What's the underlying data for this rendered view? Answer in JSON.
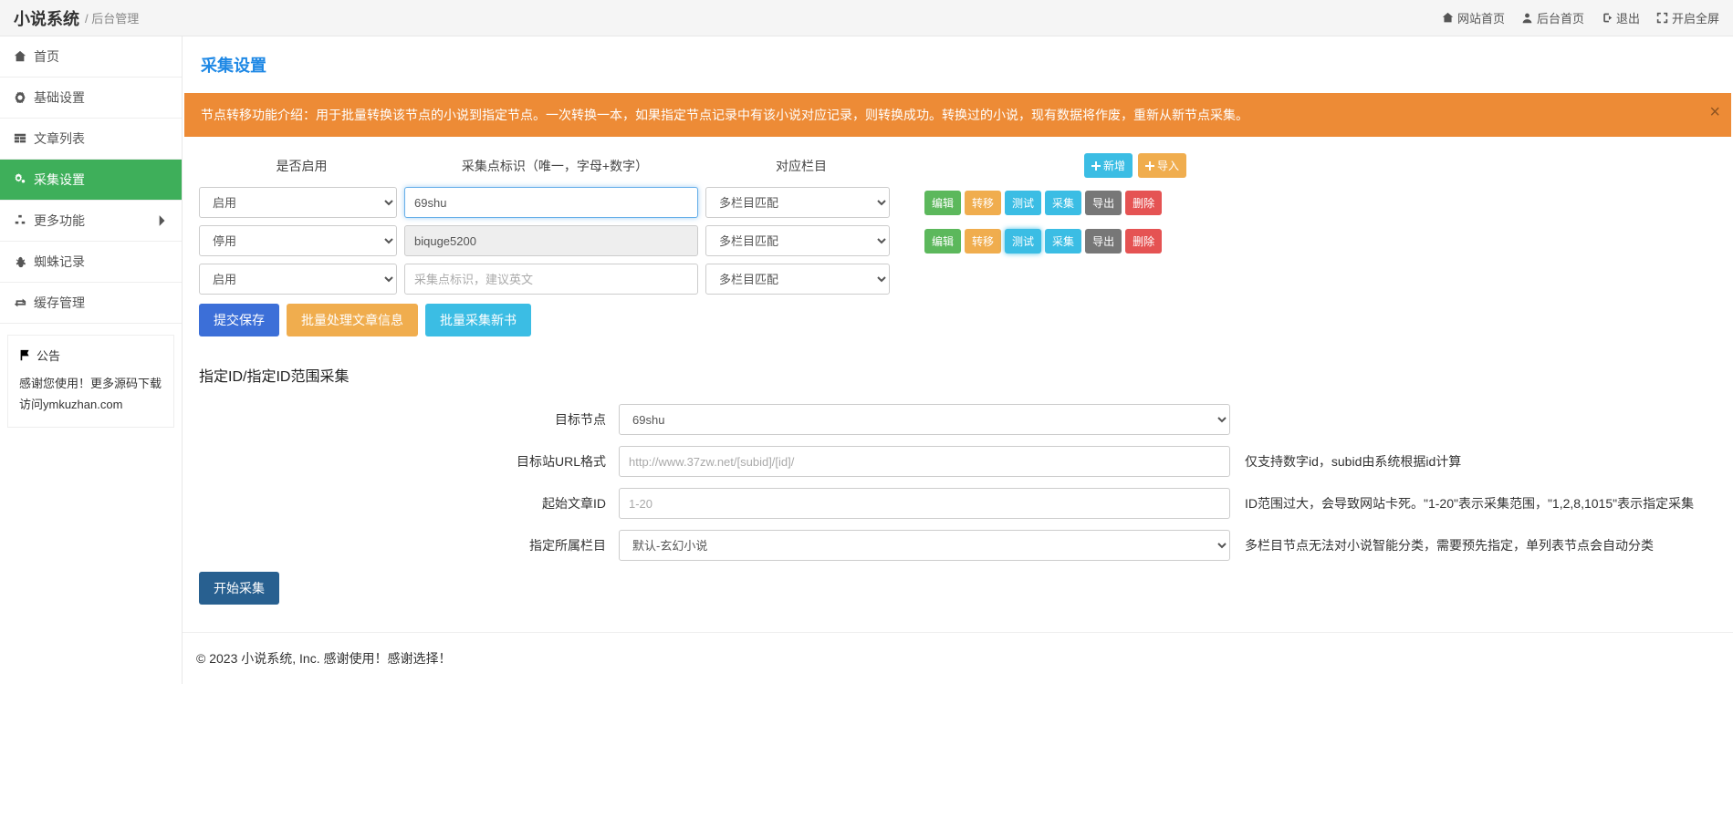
{
  "navbar": {
    "brand": "小说系统",
    "brand_sub": "/ 后台管理",
    "links": {
      "site_home": "网站首页",
      "admin_home": "后台首页",
      "logout": "退出",
      "fullscreen": "开启全屏"
    }
  },
  "sidebar": {
    "items": [
      {
        "icon": "home",
        "label": "首页"
      },
      {
        "icon": "gear",
        "label": "基础设置"
      },
      {
        "icon": "table",
        "label": "文章列表"
      },
      {
        "icon": "cogs",
        "label": "采集设置",
        "active": true
      },
      {
        "icon": "sitemap",
        "label": "更多功能",
        "chevron": true
      },
      {
        "icon": "bug",
        "label": "蜘蛛记录"
      },
      {
        "icon": "retweet",
        "label": "缓存管理"
      }
    ],
    "notice_title": "公告",
    "notice_text": "感谢您使用！更多源码下载访问ymkuzhan.com"
  },
  "page": {
    "title": "采集设置",
    "alert": "节点转移功能介绍：用于批量转换该节点的小说到指定节点。一次转换一本，如果指定节点记录中有该小说对应记录，则转换成功。转换过的小说，现有数据将作废，重新从新节点采集。"
  },
  "grid": {
    "headers": {
      "enable": "是否启用",
      "ident": "采集点标识（唯一，字母+数字）",
      "cat": "对应栏目"
    },
    "add_btn": "新增",
    "import_btn": "导入",
    "ident_placeholder": "采集点标识，建议英文",
    "enable_options": {
      "on": "启用",
      "off": "停用"
    },
    "cat_option": "多栏目匹配",
    "rows": [
      {
        "enable": "启用",
        "ident": "69shu",
        "highlight": true
      },
      {
        "enable": "停用",
        "ident": "biquge5200",
        "readonly": true
      },
      {
        "enable": "启用",
        "ident": ""
      }
    ],
    "row_actions": {
      "edit": "编辑",
      "transfer": "转移",
      "test": "测试",
      "collect": "采集",
      "export": "导出",
      "delete": "删除"
    },
    "submit": "提交保存",
    "batch_article": "批量处理文章信息",
    "batch_collect": "批量采集新书"
  },
  "section2": {
    "title": "指定ID/指定ID范围采集",
    "fields": {
      "target_node": {
        "label": "目标节点",
        "value": "69shu"
      },
      "url_format": {
        "label": "目标站URL格式",
        "placeholder": "http://www.37zw.net/[subid]/[id]/",
        "help": "仅支持数字id，subid由系统根据id计算"
      },
      "start_id": {
        "label": "起始文章ID",
        "placeholder": "1-20",
        "help": "ID范围过大，会导致网站卡死。\"1-20\"表示采集范围，\"1,2,8,1015\"表示指定采集"
      },
      "category": {
        "label": "指定所属栏目",
        "value": "默认-玄幻小说",
        "help": "多栏目节点无法对小说智能分类，需要预先指定，单列表节点会自动分类"
      }
    },
    "start_btn": "开始采集"
  },
  "footer": "© 2023 小说系统, Inc. 感谢使用！感谢选择！"
}
